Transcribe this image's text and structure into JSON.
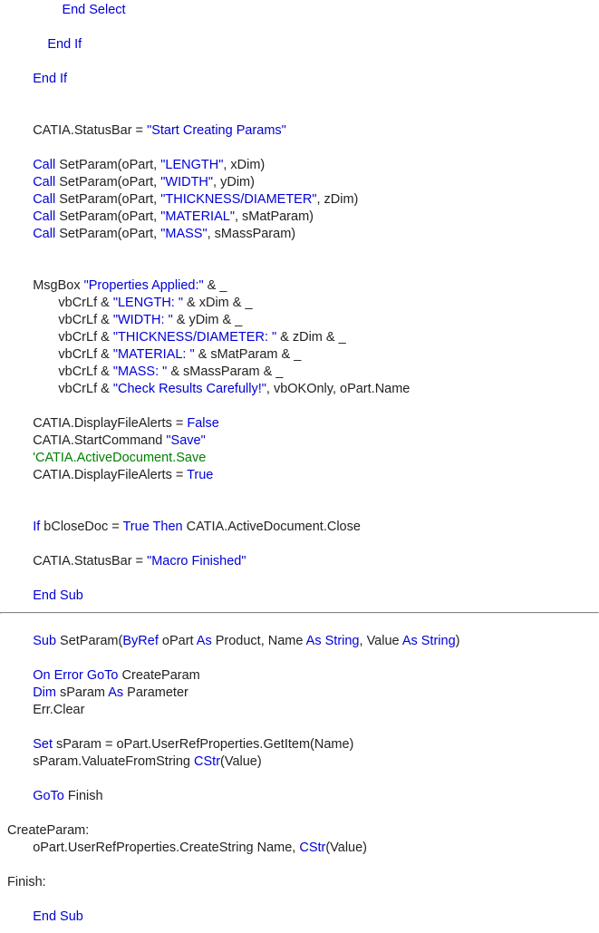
{
  "l1a": "               ",
  "l1b": "End Select",
  "l2": " ",
  "l3a": "           ",
  "l3b": "End If",
  "l4": " ",
  "l5a": "       ",
  "l5b": "End If",
  "l6": " ",
  "l7": " ",
  "l8a": "       CATIA.StatusBar = ",
  "l8b": "\"Start Creating Params\"",
  "l9": " ",
  "l10a": "       ",
  "l10b": "Call",
  "l10c": " SetParam(oPart, ",
  "l10d": "\"LENGTH\"",
  "l10e": ", xDim)",
  "l11a": "       ",
  "l11b": "Call",
  "l11c": " SetParam(oPart, ",
  "l11d": "\"WIDTH\"",
  "l11e": ", yDim)",
  "l12a": "       ",
  "l12b": "Call",
  "l12c": " SetParam(oPart, ",
  "l12d": "\"THICKNESS/DIAMETER\"",
  "l12e": ", zDim)",
  "l13a": "       ",
  "l13b": "Call",
  "l13c": " SetParam(oPart, ",
  "l13d": "\"MATERIAL\"",
  "l13e": ", sMatParam)",
  "l14a": "       ",
  "l14b": "Call",
  "l14c": " SetParam(oPart, ",
  "l14d": "\"MASS\"",
  "l14e": ", sMassParam)",
  "l15": " ",
  "l16": " ",
  "l17a": "       MsgBox ",
  "l17b": "\"Properties Applied:\"",
  "l17c": " & _",
  "l18a": "              vbCrLf & ",
  "l18b": "\"LENGTH: \"",
  "l18c": " & xDim & _",
  "l19a": "              vbCrLf & ",
  "l19b": "\"WIDTH: \"",
  "l19c": " & yDim & _",
  "l20a": "              vbCrLf & ",
  "l20b": "\"THICKNESS/DIAMETER: \"",
  "l20c": " & zDim & _",
  "l21a": "              vbCrLf & ",
  "l21b": "\"MATERIAL: \"",
  "l21c": " & sMatParam & _",
  "l22a": "              vbCrLf & ",
  "l22b": "\"MASS: \"",
  "l22c": " & sMassParam & _",
  "l23a": "              vbCrLf & ",
  "l23b": "\"Check Results Carefully!\"",
  "l23c": ", vbOKOnly, oPart.Name",
  "l24": " ",
  "l25a": "       CATIA.DisplayFileAlerts = ",
  "l25b": "False",
  "l26a": "       CATIA.StartCommand ",
  "l26b": "\"Save\"",
  "l27a": "       ",
  "l27b": "'CATIA.ActiveDocument.Save",
  "l28a": "       CATIA.DisplayFileAlerts = ",
  "l28b": "True",
  "l29": " ",
  "l30": " ",
  "l31a": "       ",
  "l31b": "If",
  "l31c": " bCloseDoc = ",
  "l31d": "True Then",
  "l31e": " CATIA.ActiveDocument.Close",
  "l32": " ",
  "l33a": "       CATIA.StatusBar = ",
  "l33b": "\"Macro Finished\"",
  "l34": " ",
  "l35a": "       ",
  "l35b": "End Sub",
  "l36": " ",
  "l37a": "       ",
  "l37b": "Sub",
  "l37c": " SetParam(",
  "l37d": "ByRef",
  "l37e": " oPart ",
  "l37f": "As",
  "l37g": " Product, Name ",
  "l37h": "As String",
  "l37i": ", Value ",
  "l37j": "As String",
  "l37k": ")",
  "l38": " ",
  "l39a": "       ",
  "l39b": "On Error GoTo",
  "l39c": " CreateParam",
  "l40a": "       ",
  "l40b": "Dim",
  "l40c": " sParam ",
  "l40d": "As",
  "l40e": " Parameter",
  "l41": "       Err.Clear",
  "l42": " ",
  "l43a": "       ",
  "l43b": "Set",
  "l43c": " sParam = oPart.UserRefProperties.GetItem(Name)",
  "l44a": "       sParam.ValuateFromString ",
  "l44b": "CStr",
  "l44c": "(Value)",
  "l45": " ",
  "l46a": "       ",
  "l46b": "GoTo",
  "l46c": " Finish",
  "l47": " ",
  "l48": "CreateParam:",
  "l49a": "       oPart.UserRefProperties.CreateString Name, ",
  "l49b": "CStr",
  "l49c": "(Value)",
  "l50": " ",
  "l51": "Finish:",
  "l52": " ",
  "l53a": "       ",
  "l53b": "End Sub"
}
